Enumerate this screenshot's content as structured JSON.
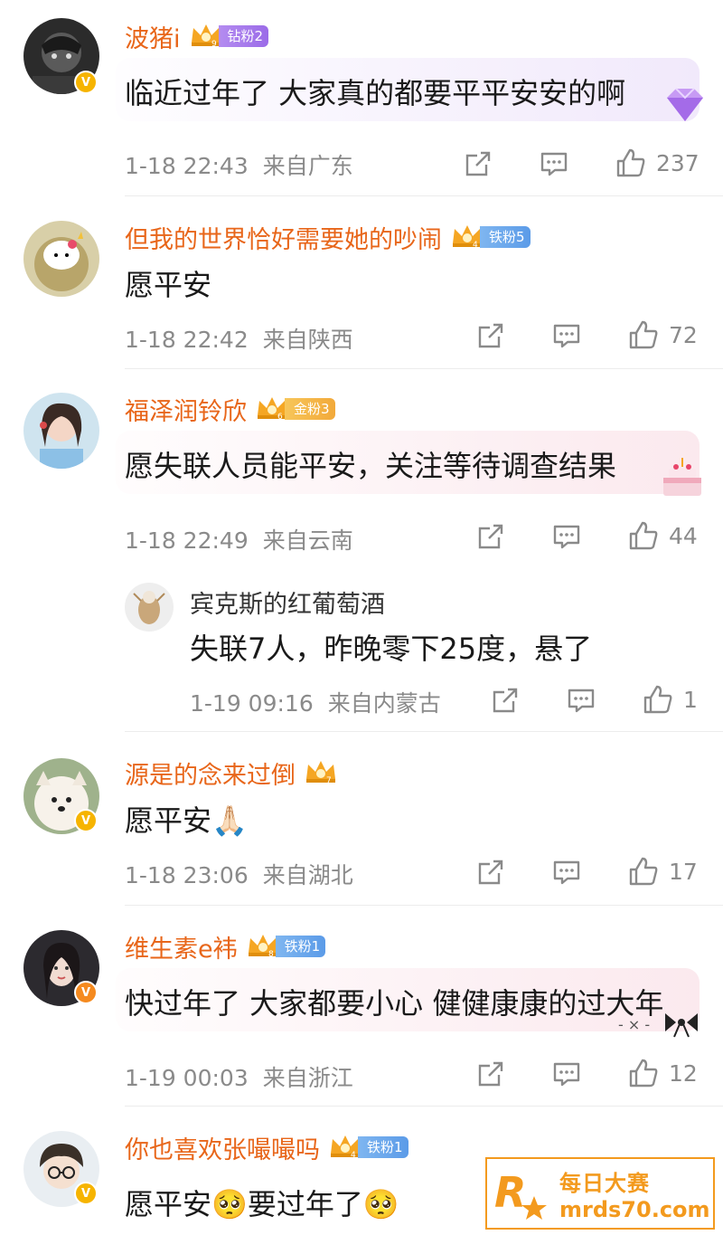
{
  "colors": {
    "username": "#e8661a",
    "meta": "#8a8a8a",
    "watermark": "#f39a1e"
  },
  "comments": [
    {
      "username": "波猪i",
      "crown_level": "9",
      "fan_badge": "钻粉2",
      "badge_kind": "diamond",
      "verified": "yellow",
      "content": "临近过年了 大家真的都要平平安安的啊",
      "timestamp": "1-18 22:43",
      "location": "来自广东",
      "likes": "237",
      "bubble": "purple",
      "sticker": "diamond-sticker"
    },
    {
      "username": "但我的世界恰好需要她的吵闹",
      "crown_level": "4",
      "fan_badge": "铁粉5",
      "badge_kind": "iron",
      "content": "愿平安",
      "timestamp": "1-18 22:42",
      "location": "来自陕西",
      "likes": "72"
    },
    {
      "username": "福泽润铃欣",
      "crown_level": "6",
      "fan_badge": "金粉3",
      "badge_kind": "gold",
      "content": "愿失联人员能平安，关注等待调查结果",
      "timestamp": "1-18 22:49",
      "location": "来自云南",
      "likes": "44",
      "bubble": "pink",
      "sticker": "cake-sticker",
      "reply": {
        "username": "宾克斯的红葡萄酒",
        "content": "失联7人，昨晚零下25度，悬了",
        "timestamp": "1-19 09:16",
        "location": "来自内蒙古",
        "likes": "1"
      }
    },
    {
      "username": "源是的念来过倒",
      "crown_level": "7",
      "verified": "yellow",
      "content": "愿平安🙏🏻",
      "timestamp": "1-18 23:06",
      "location": "来自湖北",
      "likes": "17"
    },
    {
      "username": "维生素e袆",
      "crown_level": "8",
      "fan_badge": "铁粉1",
      "badge_kind": "iron",
      "verified": "orange",
      "content": "快过年了 大家都要小心 健健康康的过大年",
      "timestamp": "1-19 00:03",
      "location": "来自浙江",
      "likes": "12",
      "bubble": "pink",
      "sticker": "bow-sticker"
    },
    {
      "username": "你也喜欢张嘬嘬吗",
      "crown_level": "4",
      "fan_badge": "铁粉1",
      "badge_kind": "iron",
      "verified": "yellow",
      "content": "愿平安🥺要过年了🥺"
    }
  ],
  "watermark": {
    "title": "每日大赛",
    "url": "mrds70.com",
    "logo_letter": "R"
  },
  "icons": [
    "share-icon",
    "comment-icon",
    "like-icon",
    "crown-icon",
    "verified-icon"
  ]
}
